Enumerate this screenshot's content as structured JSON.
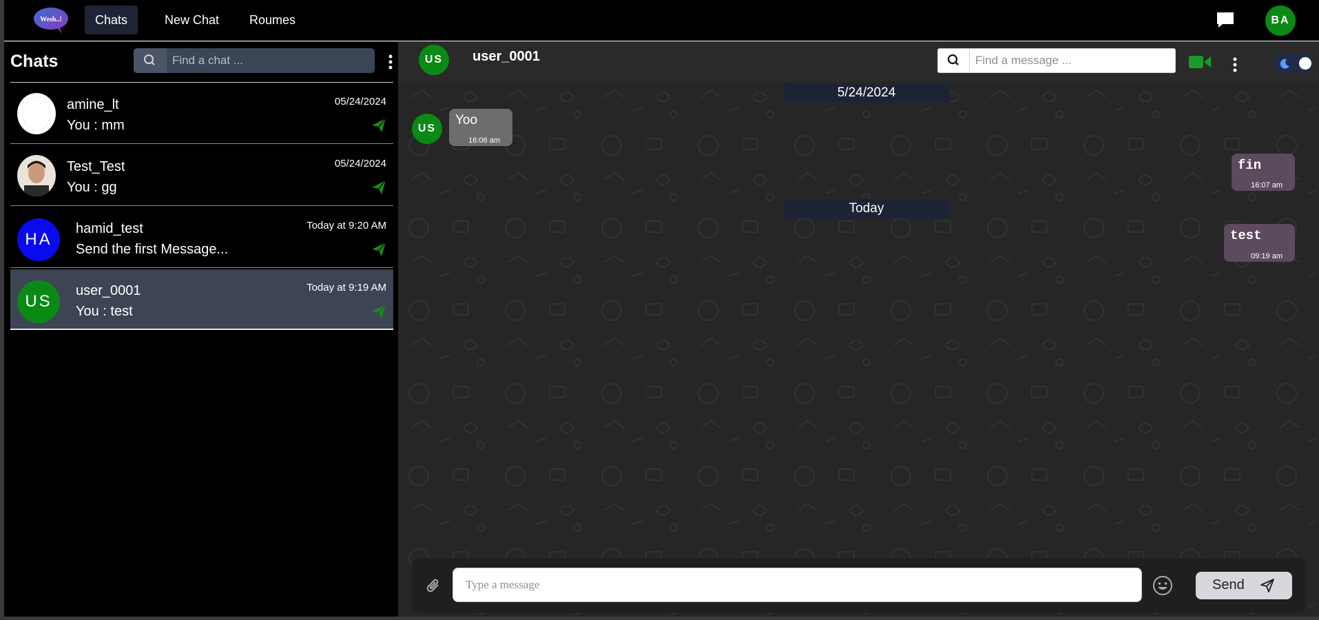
{
  "nav": {
    "logo_text": "Wesh..!",
    "items": [
      {
        "label": "Chats",
        "active": true
      },
      {
        "label": "New Chat",
        "active": false
      },
      {
        "label": "Roumes",
        "active": false
      }
    ],
    "user_initials": "BA",
    "user_color": "#0a8a14"
  },
  "sidebar": {
    "title": "Chats",
    "search_placeholder": "Find a chat ...",
    "chats": [
      {
        "name": "amine_lt",
        "last_message": "You : mm",
        "date": "05/24/2024",
        "avatar_type": "image-blank",
        "selected": false
      },
      {
        "name": "Test_Test",
        "last_message": "You : gg",
        "date": "05/24/2024",
        "avatar_type": "image-photo",
        "selected": false
      },
      {
        "name": "hamid_test",
        "last_message": "Send the first Message...",
        "date": "Today at 9:20 AM",
        "avatar_type": "initials",
        "initials": "HA",
        "avatar_color": "#0a0af0",
        "selected": false
      },
      {
        "name": "user_0001",
        "last_message": "You : test",
        "date": "Today at 9:19 AM",
        "avatar_type": "initials",
        "initials": "US",
        "avatar_color": "#0a8a14",
        "selected": true
      }
    ]
  },
  "conversation": {
    "contact_name": "user_0001",
    "contact_initials": "US",
    "search_placeholder": "Find a message ...",
    "date_separators": [
      "5/24/2024",
      "Today"
    ],
    "messages": [
      {
        "direction": "in",
        "text": "Yoo",
        "time": "16:06 am"
      },
      {
        "direction": "out",
        "text": "fin",
        "time": "16:07 am"
      },
      {
        "direction": "out",
        "text": "test",
        "time": "09:19 am"
      }
    ],
    "composer_placeholder": "Type a message",
    "send_label": "Send"
  },
  "colors": {
    "online_green": "#0a8a14",
    "send_icon_green": "#1a8a1a",
    "selected_row": "#3d4454"
  }
}
